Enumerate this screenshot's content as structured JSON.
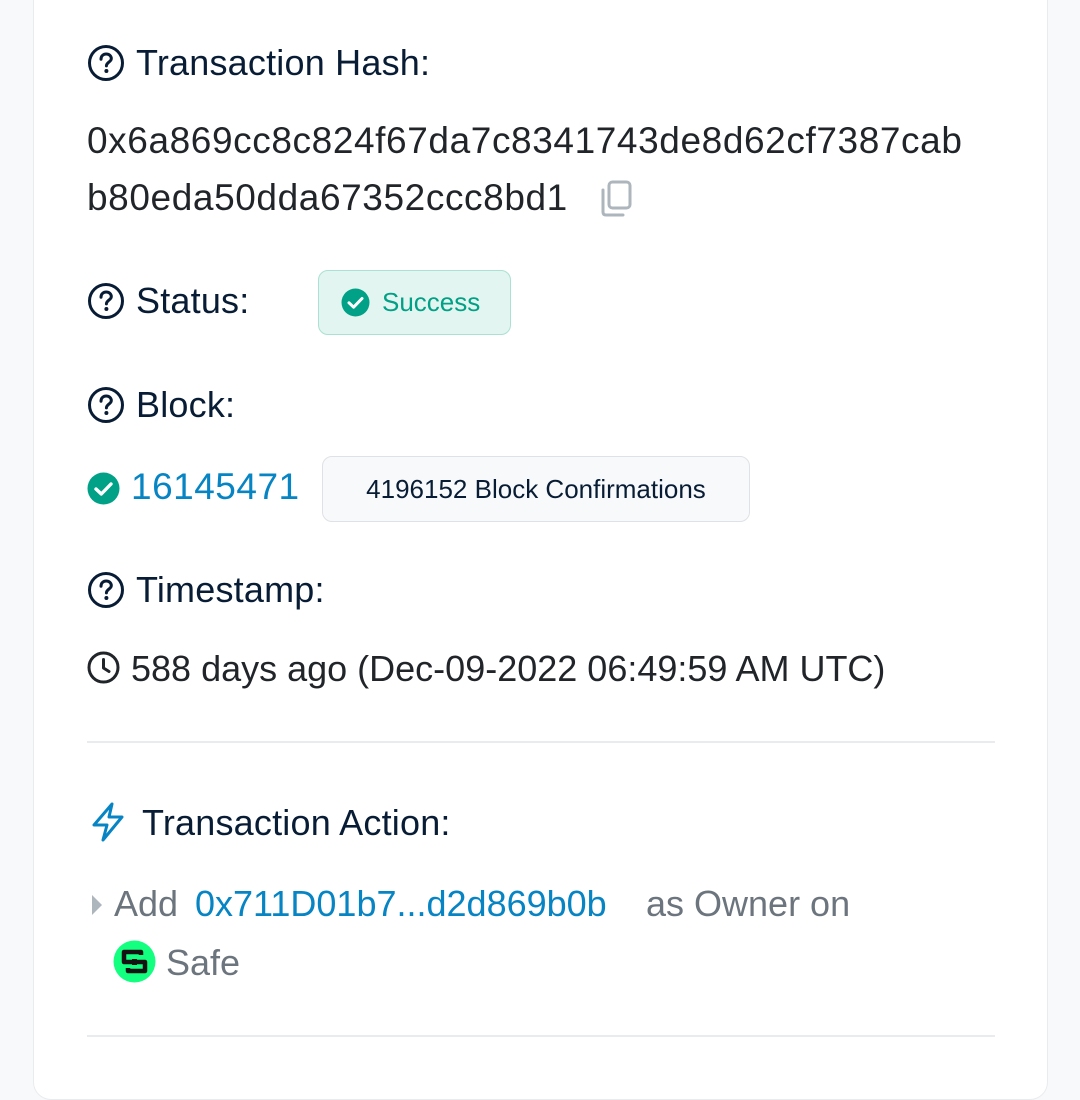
{
  "labels": {
    "tx_hash": "Transaction Hash:",
    "status": "Status:",
    "block": "Block:",
    "timestamp": "Timestamp:",
    "tx_action": "Transaction Action:"
  },
  "tx_hash": {
    "line1": "0x6a869cc8c824f67da7c8341743de8d62cf7387cab",
    "line2": "b80eda50dda67352ccc8bd1"
  },
  "status": {
    "text": "Success",
    "color": "#00a186"
  },
  "block": {
    "number": "16145471",
    "confirmations": "4196152 Block Confirmations"
  },
  "timestamp": {
    "text": "588 days ago (Dec-09-2022 06:49:59 AM UTC)"
  },
  "action": {
    "verb": "Add",
    "address": "0x711D01b7...d2d869b0b",
    "middle": "as Owner on",
    "target": "Safe"
  },
  "icons": {
    "help": "question-circle-icon",
    "copy": "copy-icon",
    "success": "check-circle-icon",
    "clock": "clock-icon",
    "bolt": "lightning-icon",
    "caret": "caret-right-icon",
    "safe": "safe-logo"
  },
  "colors": {
    "link": "#0784c3",
    "heading": "#081d35",
    "success": "#00a186"
  }
}
